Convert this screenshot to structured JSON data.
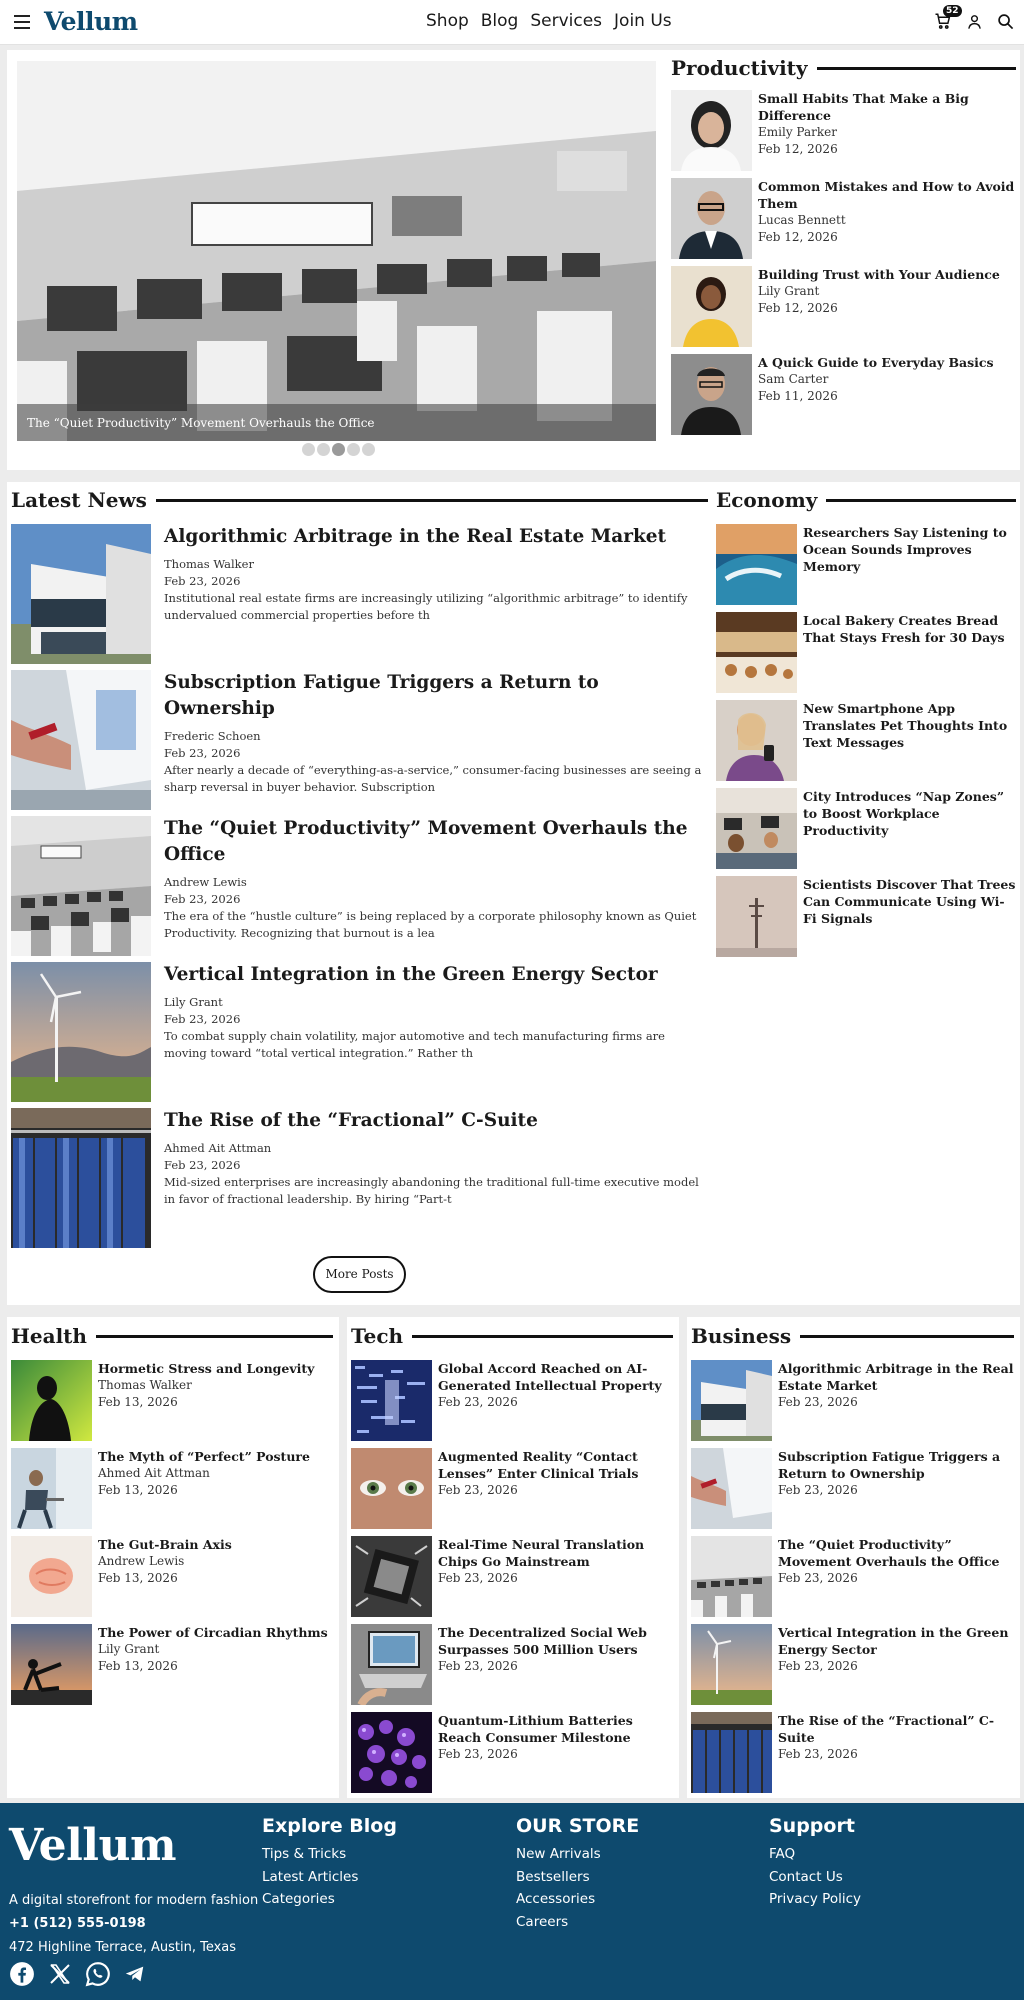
{
  "header": {
    "logo": "Vellum",
    "nav": [
      "Shop",
      "Blog",
      "Services",
      "Join Us"
    ],
    "cart_count": "52"
  },
  "hero": {
    "caption": "The “Quiet Productivity” Movement Overhauls the Office",
    "slide_count": 5,
    "active_slide": 3
  },
  "productivity": {
    "title": "Productivity",
    "items": [
      {
        "title": "Small Habits That Make a Big Difference",
        "author": "Emily Parker",
        "date": "Feb 12, 2026"
      },
      {
        "title": "Common Mistakes and How to Avoid Them",
        "author": "Lucas Bennett",
        "date": "Feb 12, 2026"
      },
      {
        "title": "Building Trust with Your Audience",
        "author": "Lily Grant",
        "date": "Feb 12, 2026"
      },
      {
        "title": "A Quick Guide to Everyday Basics",
        "author": "Sam Carter",
        "date": "Feb 11, 2026"
      }
    ]
  },
  "latest": {
    "title": "Latest News",
    "items": [
      {
        "title": "Algorithmic Arbitrage in the Real Estate Market",
        "author": "Thomas Walker",
        "date": "Feb 23, 2026",
        "excerpt": "Institutional real estate firms are increasingly utilizing “algorithmic arbitrage” to identify undervalued commercial properties before th"
      },
      {
        "title": "Subscription Fatigue Triggers a Return to Ownership",
        "author": "Frederic Schoen",
        "date": "Feb 23, 2026",
        "excerpt": "After nearly a decade of “everything-as-a-service,” consumer-facing businesses are seeing a sharp reversal in buyer behavior. Subscription"
      },
      {
        "title": "The “Quiet Productivity” Movement Overhauls the Office",
        "author": "Andrew Lewis",
        "date": "Feb 23, 2026",
        "excerpt": "The era of the “hustle culture” is being replaced by a corporate philosophy known as Quiet Productivity. Recognizing that burnout is a lea"
      },
      {
        "title": "Vertical Integration in the Green Energy Sector",
        "author": "Lily Grant",
        "date": "Feb 23, 2026",
        "excerpt": "To combat supply chain volatility, major automotive and tech manufacturing firms are moving toward “total vertical integration.” Rather th"
      },
      {
        "title": "The Rise of the “Fractional” C-Suite",
        "author": "Ahmed Ait Attman",
        "date": "Feb 23, 2026",
        "excerpt": "Mid-sized enterprises are increasingly abandoning the traditional full-time executive model in favor of fractional leadership. By hiring “Part-t"
      }
    ],
    "more_label": "More Posts"
  },
  "economy": {
    "title": "Economy",
    "items": [
      {
        "title": "Researchers Say Listening to Ocean Sounds Improves Memory"
      },
      {
        "title": "Local Bakery Creates Bread That Stays Fresh for 30 Days"
      },
      {
        "title": "New Smartphone App Translates Pet Thoughts Into Text Messages"
      },
      {
        "title": "City Introduces “Nap Zones” to Boost Workplace Productivity"
      },
      {
        "title": "Scientists Discover That Trees Can Communicate Using Wi-Fi Signals"
      }
    ]
  },
  "health": {
    "title": "Health",
    "items": [
      {
        "title": "Hormetic Stress and Longevity",
        "author": "Thomas Walker",
        "date": "Feb 13, 2026"
      },
      {
        "title": "The Myth of “Perfect” Posture",
        "author": "Ahmed Ait Attman",
        "date": "Feb 13, 2026"
      },
      {
        "title": "The Gut-Brain Axis",
        "author": "Andrew Lewis",
        "date": "Feb 13, 2026"
      },
      {
        "title": "The Power of Circadian Rhythms",
        "author": "Lily Grant",
        "date": "Feb 13, 2026"
      }
    ]
  },
  "tech": {
    "title": "Tech",
    "items": [
      {
        "title": "Global Accord Reached on AI-Generated Intellectual Property",
        "date": "Feb 23, 2026"
      },
      {
        "title": "Augmented Reality “Contact Lenses” Enter Clinical Trials",
        "date": "Feb 23, 2026"
      },
      {
        "title": "Real-Time Neural Translation Chips Go Mainstream",
        "date": "Feb 23, 2026"
      },
      {
        "title": "The Decentralized Social Web Surpasses 500 Million Users",
        "date": "Feb 23, 2026"
      },
      {
        "title": "Quantum-Lithium Batteries Reach Consumer Milestone",
        "date": "Feb 23, 2026"
      }
    ]
  },
  "business": {
    "title": "Business",
    "items": [
      {
        "title": "Algorithmic Arbitrage in the Real Estate Market",
        "date": "Feb 23, 2026"
      },
      {
        "title": "Subscription Fatigue Triggers a Return to Ownership",
        "date": "Feb 23, 2026"
      },
      {
        "title": "The “Quiet Productivity” Movement Overhauls the Office",
        "date": "Feb 23, 2026"
      },
      {
        "title": "Vertical Integration in the Green Energy Sector",
        "date": "Feb 23, 2026"
      },
      {
        "title": "The Rise of the “Fractional” C-Suite",
        "date": "Feb 23, 2026"
      }
    ]
  },
  "footer": {
    "logo": "Vellum",
    "tagline": "A digital storefront for modern fashion",
    "phone": "+1 (512) 555-0198",
    "address": "472 Highline Terrace, Austin, Texas",
    "explore": {
      "title": "Explore Blog",
      "links": [
        "Tips & Tricks",
        "Latest Articles",
        "Categories"
      ]
    },
    "store": {
      "title": "OUR STORE",
      "links": [
        "New Arrivals",
        "Bestsellers",
        "Accessories",
        "Careers"
      ]
    },
    "support": {
      "title": "Support",
      "links": [
        "FAQ",
        "Contact Us",
        "Privacy Policy"
      ]
    },
    "socials": [
      "facebook-icon",
      "x-icon",
      "whatsapp-icon",
      "telegram-icon"
    ]
  },
  "colors": {
    "brand": "#0e4a6e",
    "text": "#1a1a1a",
    "background": "#ececec"
  }
}
